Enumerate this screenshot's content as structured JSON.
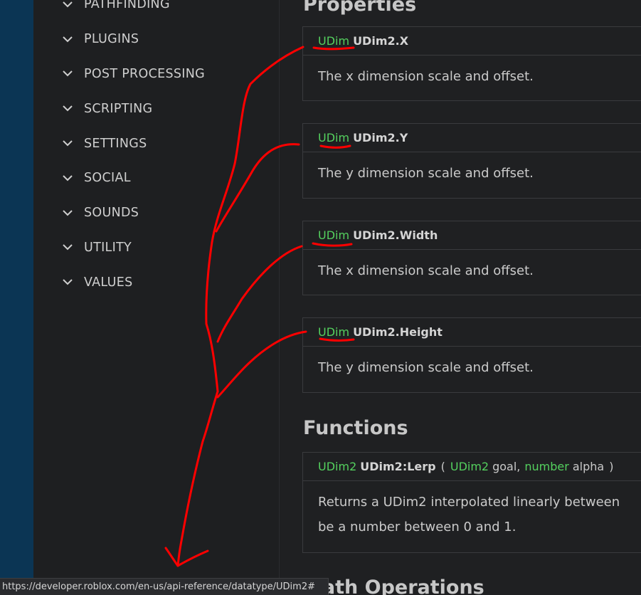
{
  "sidebar": {
    "items": [
      {
        "label": "PATHFINDING"
      },
      {
        "label": "PLUGINS"
      },
      {
        "label": "POST PROCESSING"
      },
      {
        "label": "SCRIPTING"
      },
      {
        "label": "SETTINGS"
      },
      {
        "label": "SOCIAL"
      },
      {
        "label": "SOUNDS"
      },
      {
        "label": "UTILITY"
      },
      {
        "label": "VALUES"
      }
    ]
  },
  "properties": {
    "title": "Properties",
    "items": [
      {
        "type": "UDim",
        "name": "UDim2.X",
        "description": "The x dimension scale and offset."
      },
      {
        "type": "UDim",
        "name": "UDim2.Y",
        "description": "The y dimension scale and offset."
      },
      {
        "type": "UDim",
        "name": "UDim2.Width",
        "description": "The x dimension scale and offset."
      },
      {
        "type": "UDim",
        "name": "UDim2.Height",
        "description": "The y dimension scale and offset."
      }
    ]
  },
  "functions": {
    "title": "Functions",
    "items": [
      {
        "return_type": "UDim2",
        "name": "UDim2:Lerp",
        "open_paren": "(",
        "param1_type": "UDim2",
        "param1_name": "goal,",
        "param2_type": "number",
        "param2_name": "alpha",
        "close_paren": ")",
        "description_line1": "Returns a UDim2 interpolated linearly between",
        "description_line2": "be a number between 0 and 1."
      }
    ]
  },
  "next_section": {
    "title": "Math Operations"
  },
  "status_bar": {
    "url": "https://developer.roblox.com/en-us/api-reference/datatype/UDim2#"
  },
  "colors": {
    "background": "#1f2022",
    "left_strip": "#0b3554",
    "type_green": "#54d05e",
    "annotation_red": "#ff0000"
  }
}
